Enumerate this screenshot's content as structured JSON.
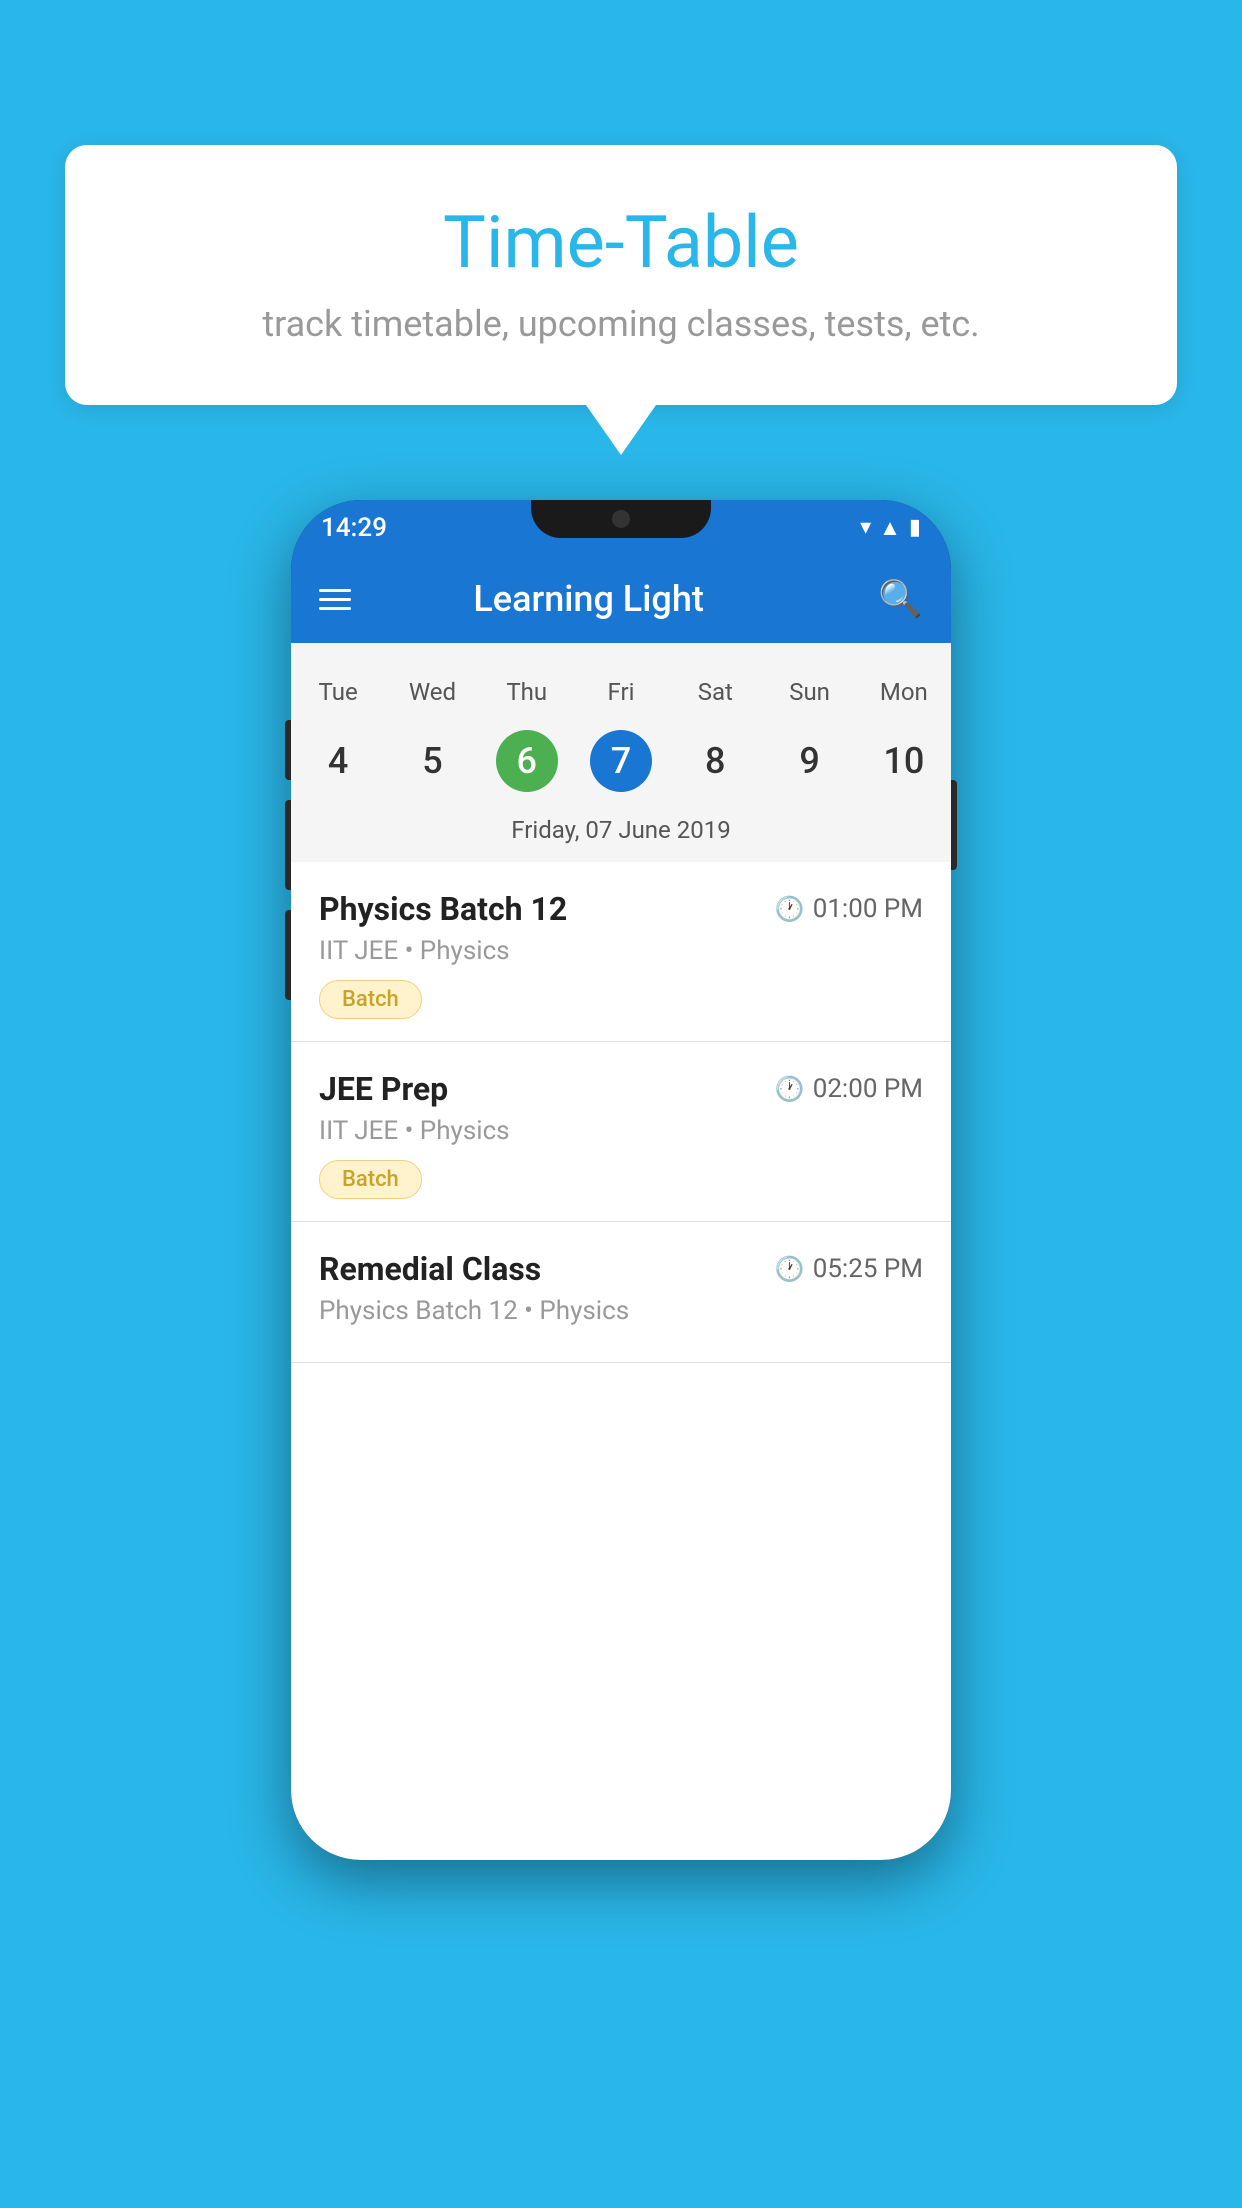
{
  "background_color": "#29b6e8",
  "speech_bubble": {
    "title": "Time-Table",
    "subtitle": "track timetable, upcoming classes, tests, etc."
  },
  "phone": {
    "status_bar": {
      "time": "14:29"
    },
    "app_bar": {
      "title": "Learning Light"
    },
    "calendar": {
      "days": [
        "Tue",
        "Wed",
        "Thu",
        "Fri",
        "Sat",
        "Sun",
        "Mon"
      ],
      "dates": [
        {
          "num": "4",
          "state": "normal"
        },
        {
          "num": "5",
          "state": "normal"
        },
        {
          "num": "6",
          "state": "today"
        },
        {
          "num": "7",
          "state": "selected"
        },
        {
          "num": "8",
          "state": "normal"
        },
        {
          "num": "9",
          "state": "normal"
        },
        {
          "num": "10",
          "state": "normal"
        }
      ],
      "selected_date_label": "Friday, 07 June 2019"
    },
    "schedule": [
      {
        "title": "Physics Batch 12",
        "time": "01:00 PM",
        "subtitle": "IIT JEE • Physics",
        "badge": "Batch"
      },
      {
        "title": "JEE Prep",
        "time": "02:00 PM",
        "subtitle": "IIT JEE • Physics",
        "badge": "Batch"
      },
      {
        "title": "Remedial Class",
        "time": "05:25 PM",
        "subtitle": "Physics Batch 12 • Physics",
        "badge": null
      }
    ]
  }
}
